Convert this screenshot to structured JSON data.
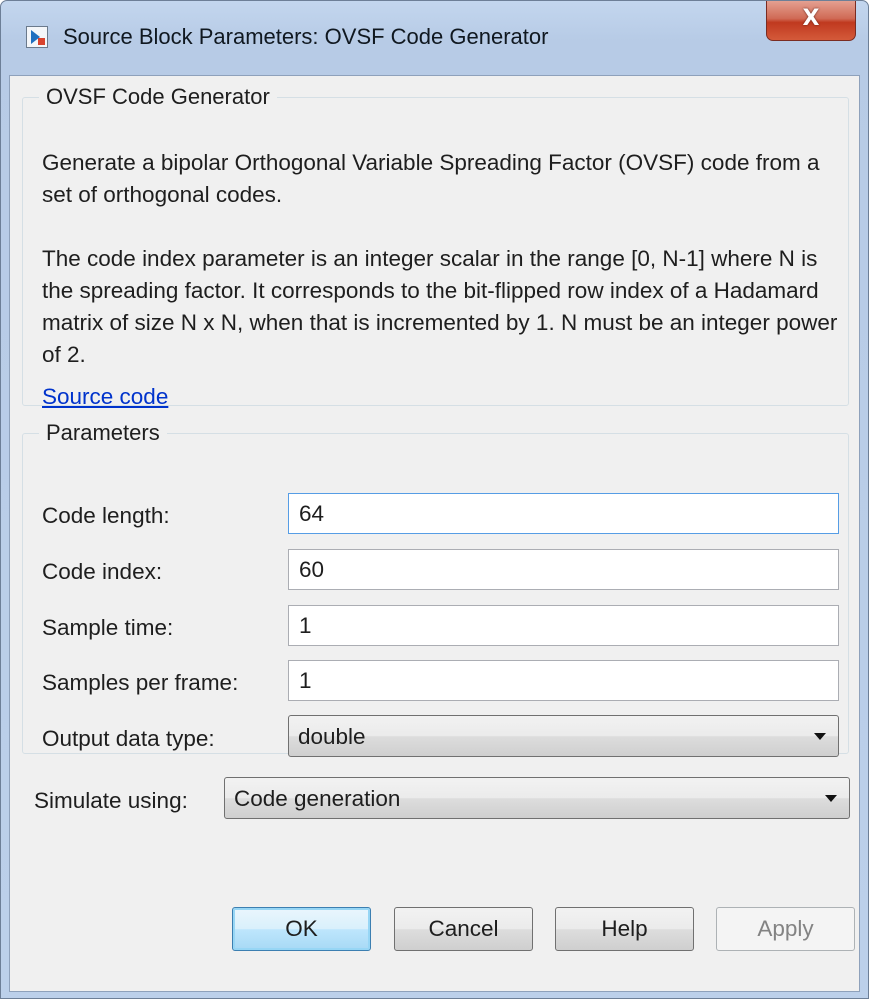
{
  "window": {
    "title": "Source Block Parameters: OVSF Code Generator",
    "close_glyph": "X"
  },
  "description_group": {
    "legend": "OVSF Code Generator",
    "paragraph1": "Generate a bipolar Orthogonal Variable Spreading Factor (OVSF) code from a set of orthogonal codes.",
    "paragraph2": "The code index parameter is an integer scalar in the range [0, N-1] where N is the spreading factor.  It corresponds to the bit-flipped row index of a Hadamard matrix of size N x N, when that is incremented by 1. N must be an integer power of 2.",
    "link": "Source code"
  },
  "parameters": {
    "legend": "Parameters",
    "fields": [
      {
        "label": "Code length:",
        "value": "64"
      },
      {
        "label": "Code index:",
        "value": "60"
      },
      {
        "label": "Sample time:",
        "value": "1"
      },
      {
        "label": "Samples per frame:",
        "value": "1"
      }
    ],
    "output_data_type": {
      "label": "Output data type:",
      "value": "double"
    }
  },
  "simulate": {
    "label": "Simulate using:",
    "value": "Code generation"
  },
  "buttons": {
    "ok": "OK",
    "cancel": "Cancel",
    "help": "Help",
    "apply": "Apply"
  },
  "colors": {
    "link": "#0033cc",
    "default_button_border": "#3c7fb1",
    "close_button": "#c0391f"
  },
  "icons": {
    "app": "simulink-block-icon",
    "close": "close-icon",
    "dropdown": "chevron-down-icon"
  }
}
